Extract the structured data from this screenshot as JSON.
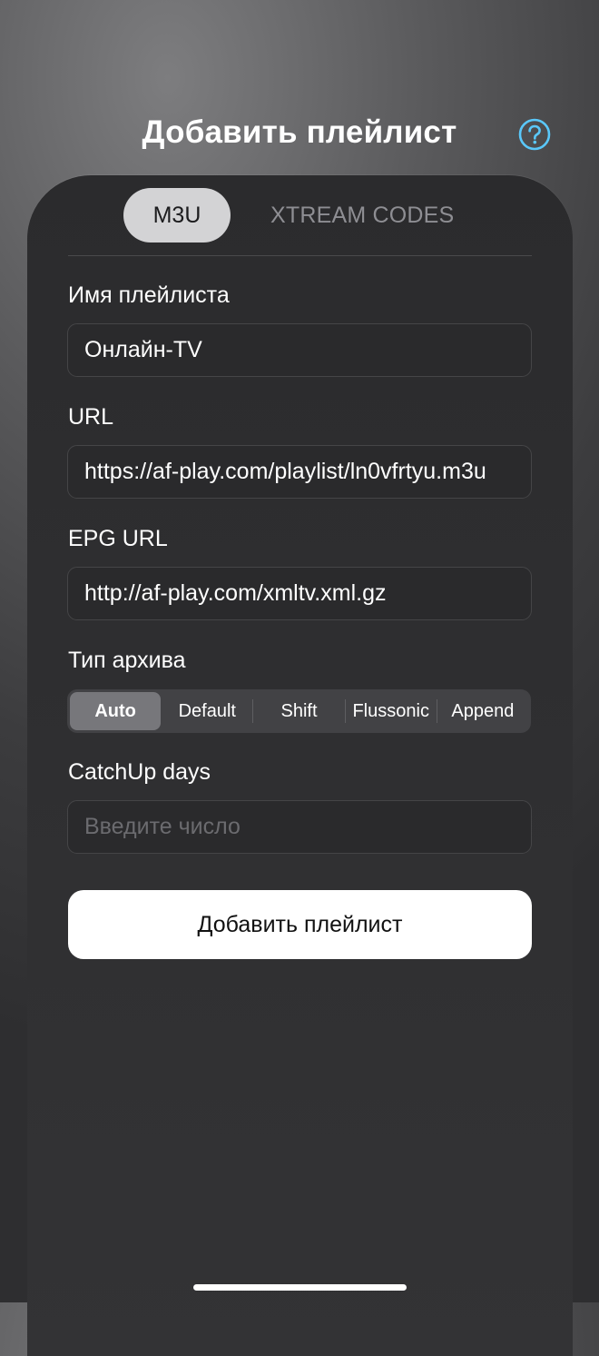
{
  "header": {
    "title": "Добавить плейлист",
    "help_icon": "question-circle-icon",
    "help_color": "#5ac8fa"
  },
  "tabs": [
    {
      "label": "M3U",
      "active": true
    },
    {
      "label": "XTREAM CODES",
      "active": false
    }
  ],
  "form": {
    "name_label": "Имя плейлиста",
    "name_value": "Онлайн-TV",
    "url_label": "URL",
    "url_value": "https://af-play.com/playlist/ln0vfrtyu.m3u",
    "epg_label": "EPG URL",
    "epg_value": "http://af-play.com/xmltv.xml.gz",
    "archive_label": "Тип архива",
    "archive_options": [
      "Auto",
      "Default",
      "Shift",
      "Flussonic",
      "Append"
    ],
    "archive_selected": "Auto",
    "catchup_label": "CatchUp days",
    "catchup_placeholder": "Введите число",
    "catchup_value": ""
  },
  "actions": {
    "add_label": "Добавить плейлист"
  },
  "colors": {
    "accent": "#5ac8fa",
    "sheet": "#2e2e30",
    "button": "#ffffff"
  }
}
